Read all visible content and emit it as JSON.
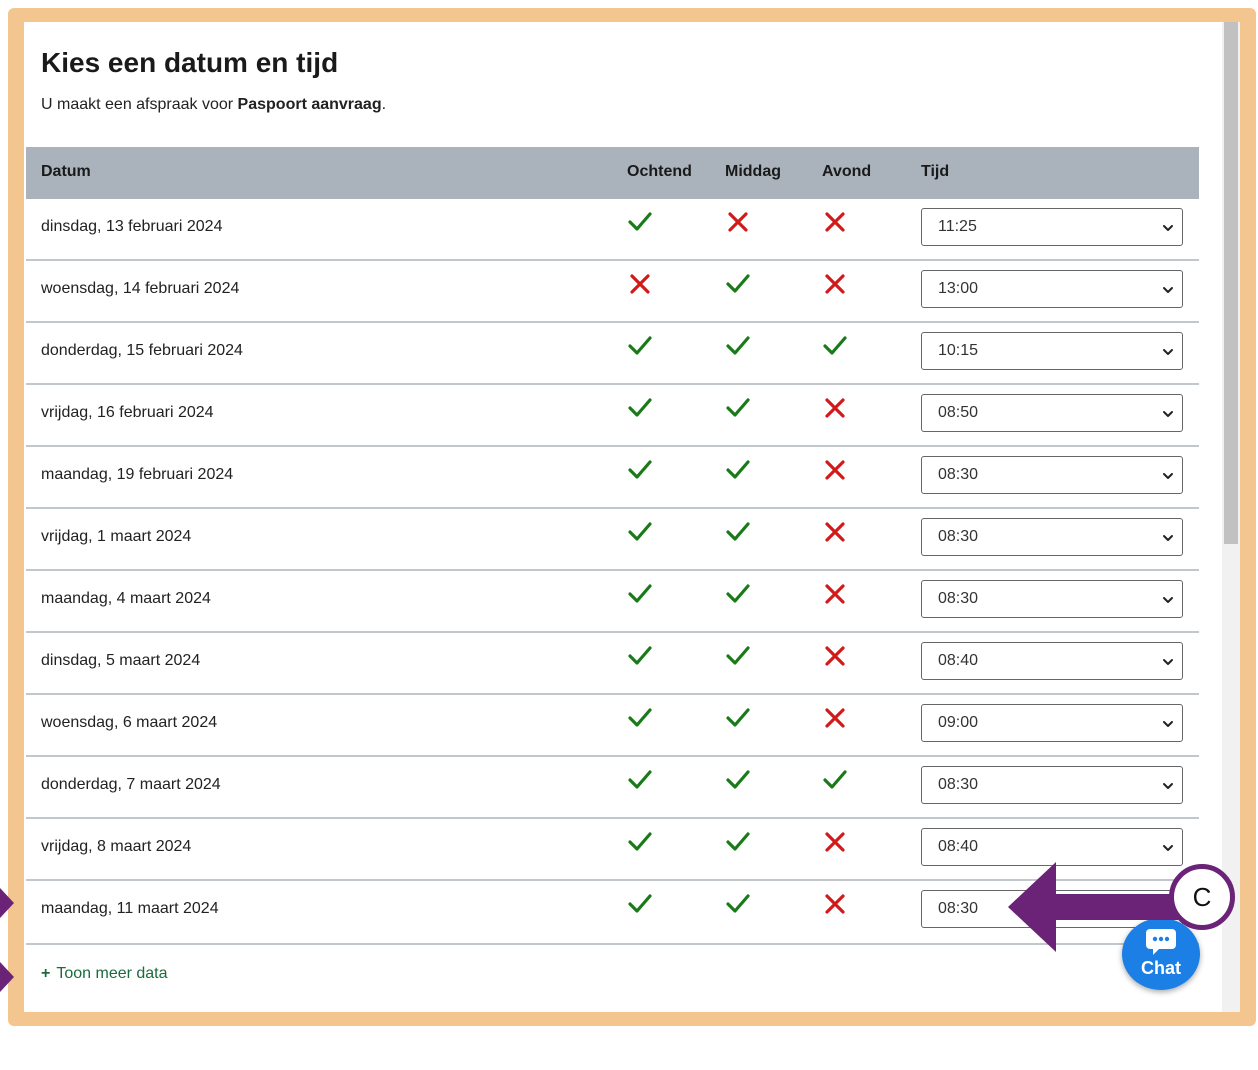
{
  "page": {
    "title": "Kies een datum en tijd",
    "intro_prefix": "U maakt een afspraak voor ",
    "intro_bold": "Paspoort aanvraag",
    "intro_suffix": "."
  },
  "table": {
    "headers": {
      "date": "Datum",
      "morning": "Ochtend",
      "afternoon": "Middag",
      "evening": "Avond",
      "time": "Tijd"
    },
    "rows": [
      {
        "date": "dinsdag, 13 februari 2024",
        "morning": true,
        "afternoon": false,
        "evening": false,
        "time": "11:25"
      },
      {
        "date": "woensdag, 14 februari 2024",
        "morning": false,
        "afternoon": true,
        "evening": false,
        "time": "13:00"
      },
      {
        "date": "donderdag, 15 februari 2024",
        "morning": true,
        "afternoon": true,
        "evening": true,
        "time": "10:15"
      },
      {
        "date": "vrijdag, 16 februari 2024",
        "morning": true,
        "afternoon": true,
        "evening": false,
        "time": "08:50"
      },
      {
        "date": "maandag, 19 februari 2024",
        "morning": true,
        "afternoon": true,
        "evening": false,
        "time": "08:30"
      },
      {
        "date": "vrijdag, 1 maart 2024",
        "morning": true,
        "afternoon": true,
        "evening": false,
        "time": "08:30"
      },
      {
        "date": "maandag, 4 maart 2024",
        "morning": true,
        "afternoon": true,
        "evening": false,
        "time": "08:30"
      },
      {
        "date": "dinsdag, 5 maart 2024",
        "morning": true,
        "afternoon": true,
        "evening": false,
        "time": "08:40"
      },
      {
        "date": "woensdag, 6 maart 2024",
        "morning": true,
        "afternoon": true,
        "evening": false,
        "time": "09:00"
      },
      {
        "date": "donderdag, 7 maart 2024",
        "morning": true,
        "afternoon": true,
        "evening": true,
        "time": "08:30"
      },
      {
        "date": "vrijdag, 8 maart 2024",
        "morning": true,
        "afternoon": true,
        "evening": false,
        "time": "08:40"
      },
      {
        "date": "maandag, 11 maart 2024",
        "morning": true,
        "afternoon": true,
        "evening": false,
        "time": "08:30"
      }
    ]
  },
  "more_link": {
    "plus": "+",
    "label": "Toon meer data"
  },
  "chat": {
    "label": "Chat"
  },
  "callout": {
    "letter": "C"
  },
  "colors": {
    "frame": "#f3c68f",
    "header_bg": "#aab3bc",
    "check": "#1a7a1a",
    "cross": "#d11a1a",
    "link": "#1a6b3e",
    "chat": "#1b7fe6",
    "annotation": "#6b2377"
  },
  "icons": {
    "available": "check-icon",
    "unavailable": "cross-icon",
    "select": "chevron-down-icon",
    "chat": "chat-bubble-icon"
  }
}
